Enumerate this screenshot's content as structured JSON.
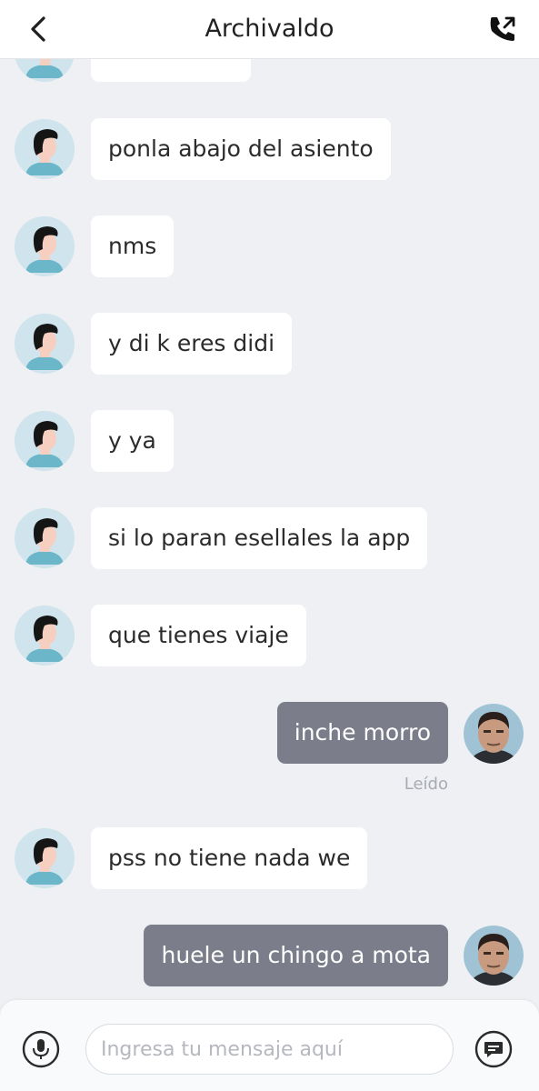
{
  "header": {
    "title": "Archivaldo"
  },
  "messages": [
    {
      "direction": "in",
      "text": ""
    },
    {
      "direction": "in",
      "text": "ponla abajo del asiento"
    },
    {
      "direction": "in",
      "text": "nms"
    },
    {
      "direction": "in",
      "text": "y di k eres didi"
    },
    {
      "direction": "in",
      "text": "y ya"
    },
    {
      "direction": "in",
      "text": "si lo paran esellales la app"
    },
    {
      "direction": "in",
      "text": "que tienes viaje"
    },
    {
      "direction": "out",
      "text": "inche morro",
      "status": "Leído"
    },
    {
      "direction": "in",
      "text": "pss no tiene nada we"
    },
    {
      "direction": "out",
      "text": "huele un chingo a mota"
    }
  ],
  "composer": {
    "placeholder": "Ingresa tu mensaje aquí"
  },
  "icons": {
    "back": "chevron-left-icon",
    "call": "phone-outgoing-icon",
    "mic": "microphone-icon",
    "quick_reply": "message-icon"
  },
  "colors": {
    "outgoing_bubble": "#7b7d8a",
    "incoming_bubble": "#ffffff",
    "background": "#eef0f3"
  }
}
